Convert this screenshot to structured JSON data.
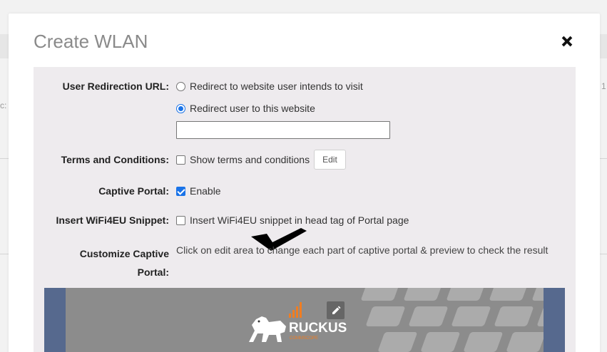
{
  "modal": {
    "title": "Create WLAN"
  },
  "redirection": {
    "label": "User Redirection URL:",
    "option_intended": "Redirect to website user intends to visit",
    "option_custom": "Redirect user to this website",
    "selected": "option_custom",
    "url_value": ""
  },
  "terms": {
    "label": "Terms and Conditions:",
    "checkbox_label": "Show terms and conditions",
    "checked": false,
    "edit_label": "Edit"
  },
  "captive_portal": {
    "label": "Captive Portal:",
    "checkbox_label": "Enable",
    "checked": true
  },
  "wifi4eu": {
    "label": "Insert WiFi4EU Snippet:",
    "checkbox_label": "Insert WiFi4EU snippet in head tag of Portal page",
    "checked": false
  },
  "customize": {
    "label_line1": "Customize Captive",
    "label_line2": "Portal:",
    "description": "Click on edit area to change each part of captive portal & preview to check the result"
  },
  "preview": {
    "logo_text": "RUCKUS",
    "logo_subtext": "COMMSCOPE",
    "accent_color": "#f07d22",
    "frame_color": "#56698e"
  },
  "background": {
    "left_fragment": "c:",
    "right_fragment": "1"
  },
  "colors": {
    "accent_blue": "#1a73e8",
    "panel_bg": "#eeebee"
  }
}
